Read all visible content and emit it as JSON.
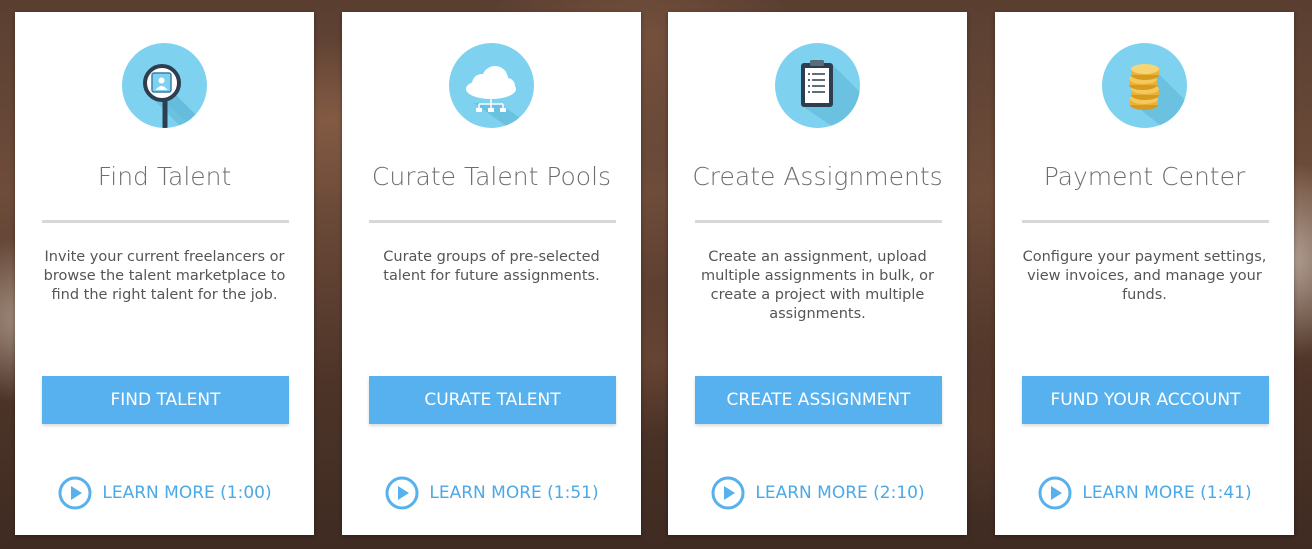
{
  "colors": {
    "icon_circle": "#7fd2ef",
    "button": "#56b1ee",
    "link": "#4aa9e6",
    "title": "#6d6d6d",
    "card": "#ffffff"
  },
  "cards": [
    {
      "icon": "magnifier-profile-icon",
      "title": "Find Talent",
      "description": "Invite your current freelancers or browse the talent marketplace to find the right talent for the job.",
      "button_label": "FIND TALENT",
      "learn_more_label": "LEARN MORE (1:00)"
    },
    {
      "icon": "cloud-network-icon",
      "title": "Curate Talent Pools",
      "description": "Curate groups of pre-selected talent for future assignments.",
      "button_label": "CURATE TALENT",
      "learn_more_label": "LEARN MORE (1:51)"
    },
    {
      "icon": "clipboard-icon",
      "title": "Create Assignments",
      "description": "Create an assignment, upload multiple assignments in bulk, or create a project with multiple assignments.",
      "button_label": "CREATE ASSIGNMENT",
      "learn_more_label": "LEARN MORE (2:10)"
    },
    {
      "icon": "coin-stack-icon",
      "title": "Payment Center",
      "description": "Configure your payment settings, view invoices, and manage your funds.",
      "button_label": "FUND YOUR ACCOUNT",
      "learn_more_label": "LEARN MORE (1:41)"
    }
  ]
}
